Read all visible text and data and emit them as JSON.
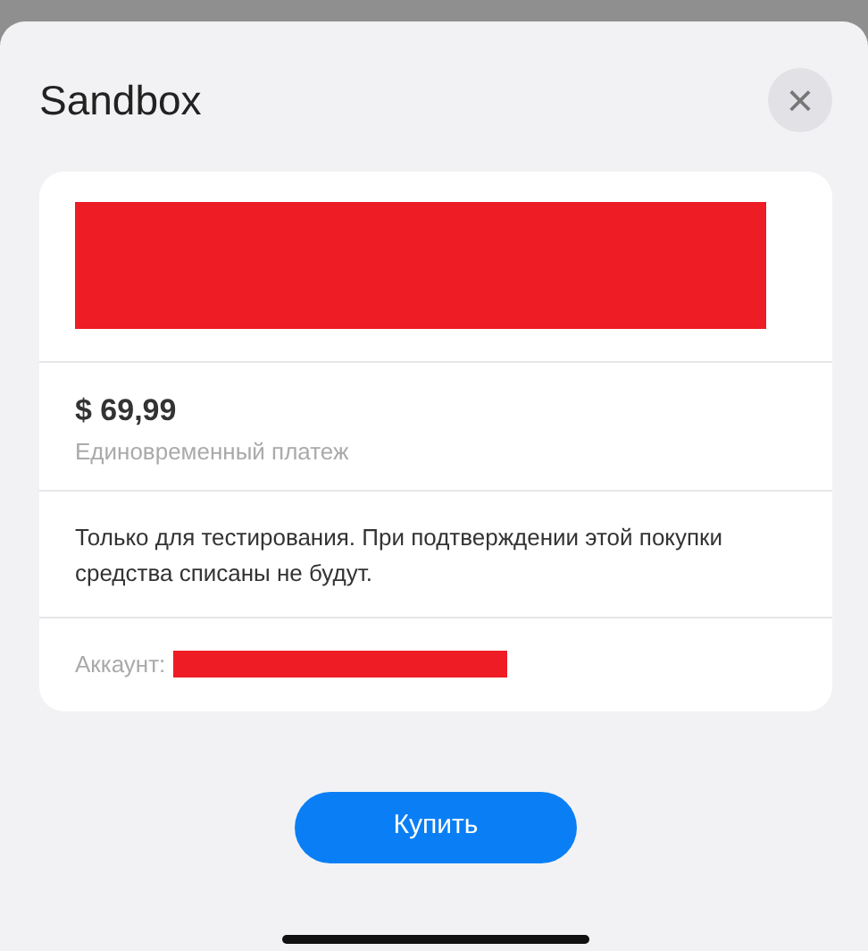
{
  "sheet": {
    "title": "Sandbox",
    "close": "×"
  },
  "product": {
    "price": "$ 69,99",
    "billing": "Единовременный платеж"
  },
  "notice": "Только для тестирования. При подтверждении этой покупки средства списаны не будут.",
  "account": {
    "label": "Аккаунт:"
  },
  "buttons": [
    "Купить"
  ]
}
